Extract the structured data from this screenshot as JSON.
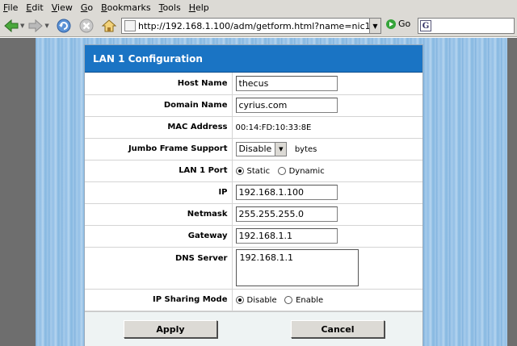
{
  "menu": [
    "File",
    "Edit",
    "View",
    "Go",
    "Bookmarks",
    "Tools",
    "Help"
  ],
  "toolbar": {
    "url": "http://192.168.1.100/adm/getform.html?name=nic1",
    "go_label": "Go",
    "search_icon_letter": "G"
  },
  "form": {
    "title": "LAN 1 Configuration",
    "host_name": {
      "label": "Host Name",
      "value": "thecus"
    },
    "domain_name": {
      "label": "Domain Name",
      "value": "cyrius.com"
    },
    "mac_address": {
      "label": "MAC Address",
      "value": "00:14:FD:10:33:8E"
    },
    "jumbo_frame": {
      "label": "Jumbo Frame Support",
      "value": "Disable",
      "unit": "bytes"
    },
    "lan_port": {
      "label": "LAN 1 Port",
      "option_static": "Static",
      "option_dynamic": "Dynamic",
      "selected": "Static"
    },
    "ip": {
      "label": "IP",
      "value": "192.168.1.100"
    },
    "netmask": {
      "label": "Netmask",
      "value": "255.255.255.0"
    },
    "gateway": {
      "label": "Gateway",
      "value": "192.168.1.1"
    },
    "dns": {
      "label": "DNS Server",
      "value": "192.168.1.1"
    },
    "ip_sharing": {
      "label": "IP Sharing Mode",
      "option_disable": "Disable",
      "option_enable": "Enable",
      "selected": "Disable"
    },
    "apply_label": "Apply",
    "cancel_label": "Cancel"
  },
  "colors": {
    "title_bar": "#1a74c4",
    "chrome": "#dcdad5",
    "background_stripes": "#92bfe6"
  }
}
